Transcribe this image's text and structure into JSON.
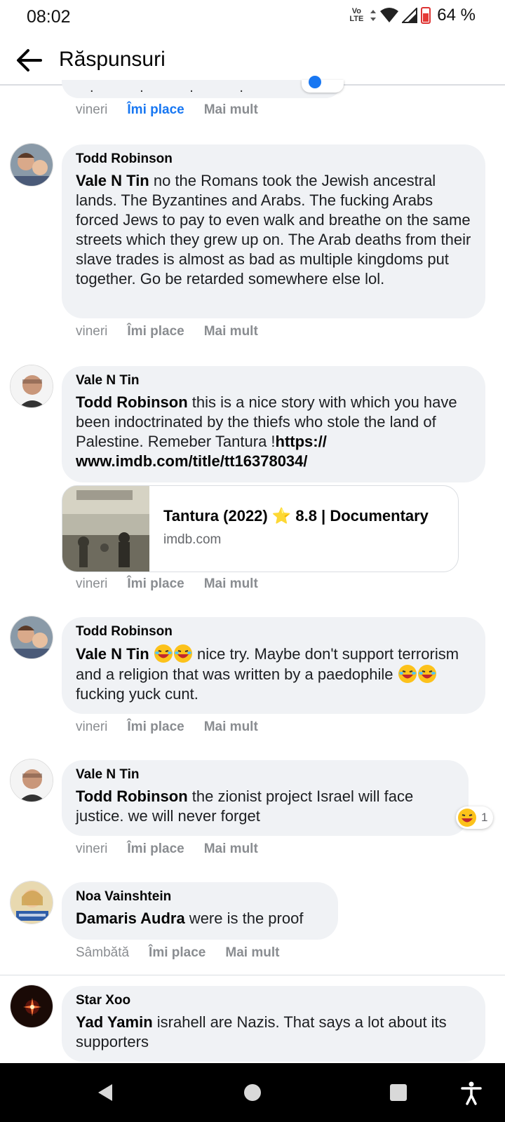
{
  "status_bar": {
    "time": "08:02",
    "volte_top": "Vo",
    "volte_bottom": "LTE",
    "battery": "64 %"
  },
  "header": {
    "title": "Răspunsuri",
    "back_icon": "arrow-left-icon"
  },
  "prev_actions": {
    "time": "vineri",
    "like": "Îmi place",
    "more": "Mai mult"
  },
  "comments": [
    {
      "author": "Todd Robinson",
      "mention": "Vale N Tin",
      "text": " no the Romans took the Jewish ancestral lands. The Byzantines and Arabs. The fucking Arabs forced Jews to pay to even walk and breathe on the same streets which they grew up on. The Arab deaths from their slave trades is almost as bad as multiple kingdoms put together. Go be retarded somewhere else lol.",
      "time": "vineri",
      "like": "Îmi place",
      "more": "Mai mult"
    },
    {
      "author": "Vale N Tin",
      "mention": "Todd Robinson",
      "text": " this is a nice story with which you have been indoctrinated by the thiefs who stole the land of Palestine. Remeber Tantura !",
      "link_text": "https://\nwww.imdb.com/title/tt16378034/",
      "link_card": {
        "title": "Tantura (2022) ⭐ 8.8 | Documentary",
        "domain": "imdb.com"
      },
      "time": "vineri",
      "like": "Îmi place",
      "more": "Mai mult"
    },
    {
      "author": "Todd Robinson",
      "mention": "Vale N Tin",
      "text_a": " nice try. Maybe don't support terrorism and a religion that was written by a paedophile ",
      "text_b": " fucking yuck cunt.",
      "time": "vineri",
      "like": "Îmi place",
      "more": "Mai mult"
    },
    {
      "author": "Vale N Tin",
      "mention": "Todd Robinson",
      "text": " the zionist project Israel will face justice. we will never forget",
      "reaction_count": "1",
      "time": "vineri",
      "like": "Îmi place",
      "more": "Mai mult"
    },
    {
      "author": "Noa Vainshtein",
      "mention": "Damaris Audra",
      "text": " were is the proof",
      "time": "Sâmbătă",
      "like": "Îmi place",
      "more": "Mai mult"
    },
    {
      "author": "Star Xoo",
      "mention": "Yad Yamin",
      "text": " israhell are Nazis. That says a lot about its supporters"
    }
  ],
  "colors": {
    "bubble": "#f0f2f5",
    "link_blue": "#1877f2",
    "meta_gray": "#8a8d91"
  }
}
